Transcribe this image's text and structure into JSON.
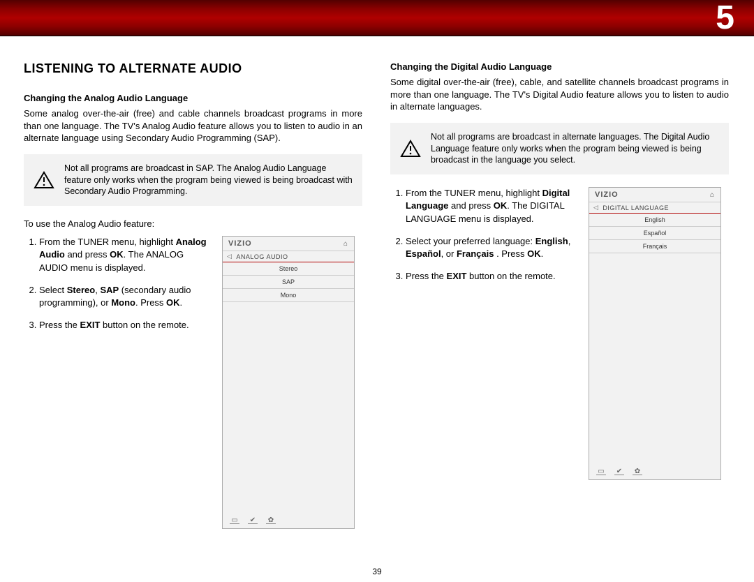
{
  "chapter_number": "5",
  "page_number": "39",
  "left": {
    "main_title": "LISTENING TO ALTERNATE AUDIO",
    "sub1_title": "Changing the Analog Audio Language",
    "sub1_body": "Some analog over-the-air (free) and cable channels broadcast programs in more than one language. The TV's Analog Audio feature allows you to listen to audio in an alternate language using Secondary Audio Programming (SAP).",
    "note1": "Not all programs are broadcast in SAP. The Analog Audio Language feature only works when the program being viewed is being broadcast with Secondary Audio Programming.",
    "lead": "To use the Analog Audio feature:",
    "steps": [
      {
        "pre": "From the TUNER menu, highlight ",
        "b1": "Analog Audio",
        "mid": " and press ",
        "b2": "OK",
        "post": ". The ANALOG AUDIO menu is displayed."
      },
      {
        "pre": "Select ",
        "b1": "Stereo",
        "mid1": ", ",
        "b2": "SAP",
        "mid2": " (secondary audio programming), or ",
        "b3": "Mono",
        "mid3": ". Press ",
        "b4": "OK",
        "post": "."
      },
      {
        "pre": "Press the ",
        "b1": "EXIT",
        "post": " button on the remote."
      }
    ],
    "panel": {
      "brand": "VIZIO",
      "menu_title": "ANALOG AUDIO",
      "items": [
        "Stereo",
        "SAP",
        "Mono"
      ]
    }
  },
  "right": {
    "sub2_title": "Changing the Digital Audio Language",
    "sub2_body": "Some digital over-the-air (free), cable, and satellite channels broadcast programs in more than one language. The TV's Digital Audio feature allows you to listen to audio in alternate languages.",
    "note2": "Not all programs are broadcast in alternate languages. The Digital Audio Language feature only works when the program being viewed is being broadcast in the language you select.",
    "steps": [
      {
        "pre": "From the TUNER menu, highlight ",
        "b1": "Digital Language",
        "mid": " and press ",
        "b2": "OK",
        "post": ". The DIGITAL LANGUAGE menu is displayed."
      },
      {
        "pre": "Select your preferred language: ",
        "b1": "English",
        "mid1": ", ",
        "b2": "Español",
        "mid2": ",  or ",
        "b3": "Français",
        "mid3": " . Press ",
        "b4": "OK",
        "post": "."
      },
      {
        "pre": "Press the ",
        "b1": "EXIT",
        "post": " button on the remote."
      }
    ],
    "panel": {
      "brand": "VIZIO",
      "menu_title": "DIGITAL LANGUAGE",
      "items": [
        "English",
        "Español",
        "Français"
      ]
    }
  }
}
